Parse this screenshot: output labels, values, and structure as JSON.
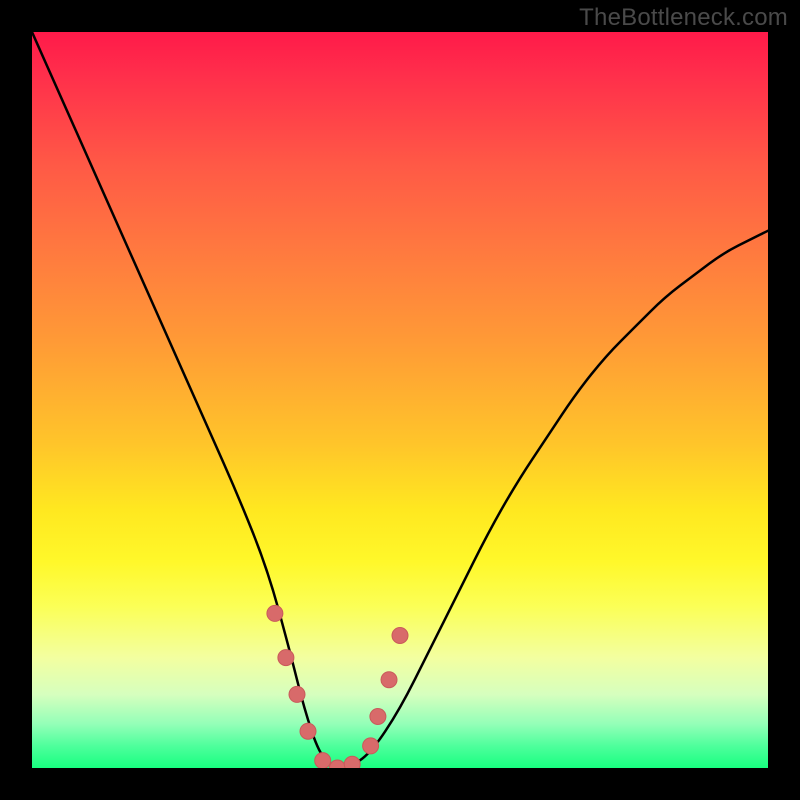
{
  "watermark": "TheBottleneck.com",
  "colors": {
    "curve": "#000000",
    "marker_fill": "#d86a6a",
    "marker_stroke": "#c95a5a",
    "background_black": "#000000"
  },
  "chart_data": {
    "type": "line",
    "title": "",
    "xlabel": "",
    "ylabel": "",
    "xlim": [
      0,
      100
    ],
    "ylim": [
      0,
      100
    ],
    "grid": false,
    "legend": false,
    "note": "Curve depicts bottleneck/mismatch percentage (y, 0=ideal at bottom) vs. some component scaling (x). Values estimated from pixel positions; no numeric axis labels present in image.",
    "series": [
      {
        "name": "bottleneck-curve",
        "x": [
          0,
          4,
          8,
          12,
          16,
          20,
          24,
          28,
          32,
          35,
          37,
          39,
          41,
          43,
          46,
          50,
          54,
          58,
          62,
          66,
          70,
          74,
          78,
          82,
          86,
          90,
          94,
          98,
          100
        ],
        "y": [
          100,
          91,
          82,
          73,
          64,
          55,
          46,
          37,
          27,
          16,
          8,
          2,
          0,
          0,
          2,
          8,
          16,
          24,
          32,
          39,
          45,
          51,
          56,
          60,
          64,
          67,
          70,
          72,
          73
        ]
      }
    ],
    "markers": {
      "name": "highlight-near-minimum",
      "color": "#d86a6a",
      "radius": 8,
      "points_x": [
        33.0,
        34.5,
        36.0,
        37.5,
        39.5,
        41.5,
        43.5,
        46.0,
        47.0,
        48.5,
        50.0
      ],
      "points_y": [
        21.0,
        15.0,
        10.0,
        5.0,
        1.0,
        0.0,
        0.5,
        3.0,
        7.0,
        12.0,
        18.0
      ]
    }
  }
}
